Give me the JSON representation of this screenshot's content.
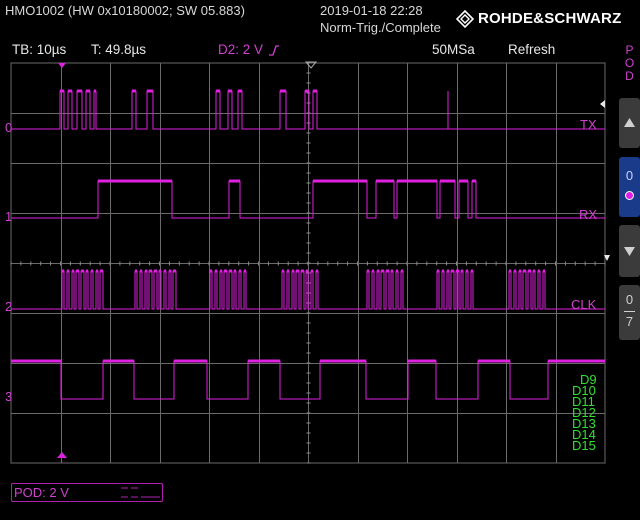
{
  "header": {
    "model": "HMO1002 (HW 0x10180002; SW 05.883)",
    "datetime": "2019-01-18 22:28",
    "trigger_mode": "Norm-Trig./Complete",
    "brand": "ROHDE&SCHWARZ"
  },
  "status_bar": {
    "timebase": "TB: 10µs",
    "trigger_time": "T: 49.8µs",
    "trigger_source": "D2: 2 V",
    "trigger_edge_icon": "rising-edge-icon",
    "sample_rate": "50MSa",
    "acquire_mode": "Refresh"
  },
  "side_panel": {
    "pod_title": [
      "P",
      "O",
      "D"
    ],
    "pod_index": "0",
    "page_top": "0",
    "page_bottom": "7"
  },
  "channels": [
    {
      "index": "0",
      "name": "TX"
    },
    {
      "index": "1",
      "name": "RX"
    },
    {
      "index": "2",
      "name": "CLK"
    },
    {
      "index": "3",
      "name": ""
    }
  ],
  "digital_list": [
    "D9",
    "D10",
    "D11",
    "D12",
    "D13",
    "D14",
    "D15"
  ],
  "pod_setting": "POD: 2 V",
  "colors": {
    "trace": "#e020e0",
    "grid": "#6a6a6a",
    "digital_label": "#30e030",
    "text": "#e8e8e8",
    "panel": "#3b3b3b"
  }
}
